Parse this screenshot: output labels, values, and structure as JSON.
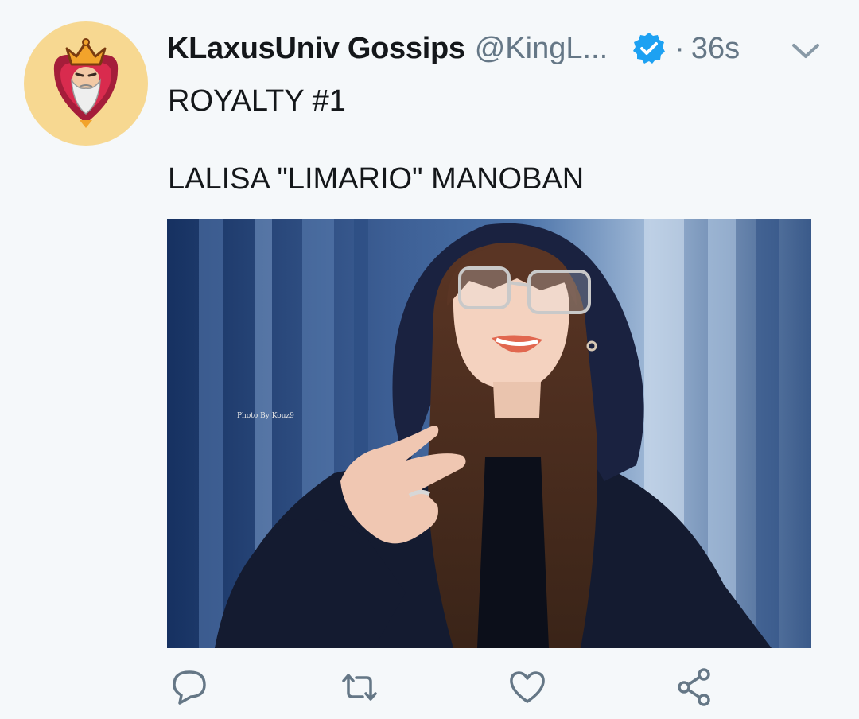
{
  "tweet": {
    "author_name": "KLaxusUniv Gossips",
    "author_handle": "@KingL...",
    "separator": "·",
    "timestamp": "36s",
    "text_line1": "ROYALTY #1",
    "text_line2": "LALISA \"LIMARIO\" MANOBAN",
    "verified": true
  },
  "media": {
    "watermark": "Photo By Kouz9"
  },
  "icons": {
    "avatar": "king-mascot-icon",
    "verified": "verified-badge-icon",
    "menu": "chevron-down-icon",
    "reply": "reply-icon",
    "retweet": "retweet-icon",
    "like": "heart-icon",
    "share": "share-icon"
  },
  "colors": {
    "background": "#f5f8fa",
    "text": "#14171a",
    "muted": "#657786",
    "verified": "#1da1f2",
    "avatar_bg": "#f7d891"
  }
}
